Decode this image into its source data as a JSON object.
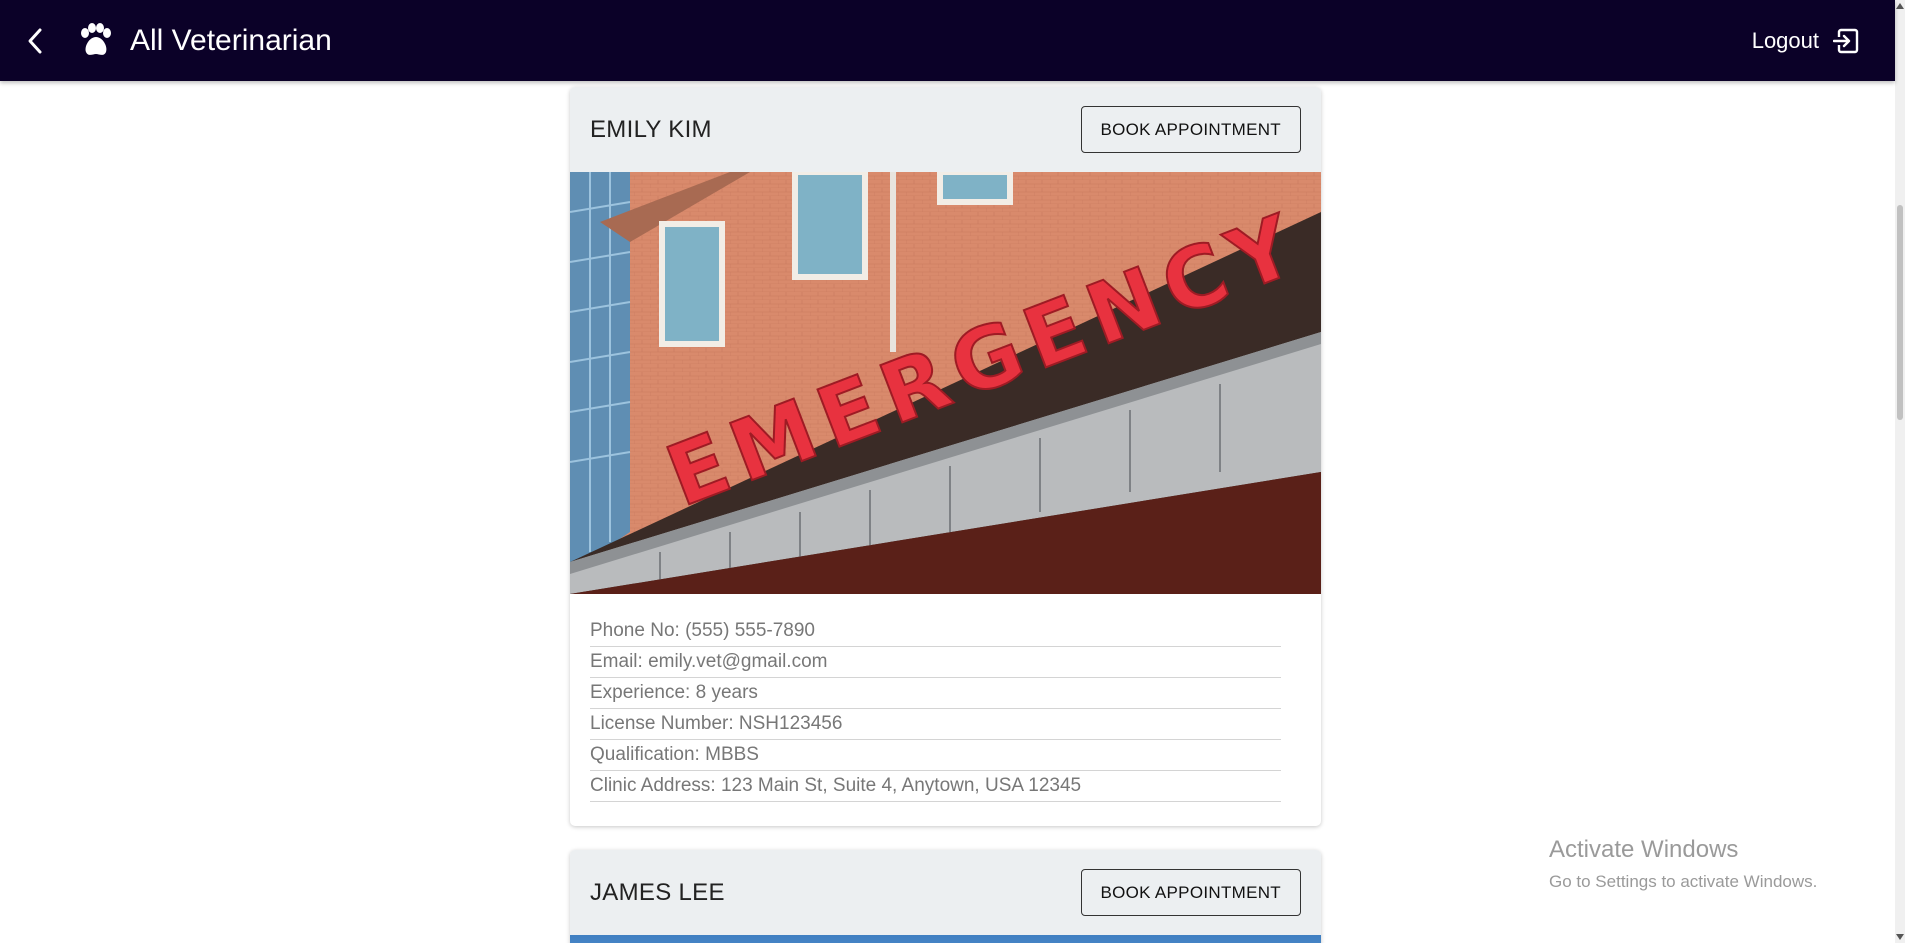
{
  "appbar": {
    "title": "All Veterinarian",
    "logout_label": "Logout",
    "back_icon": "chevron-left-icon",
    "logo_icon": "paw-icon",
    "logout_icon": "logout-icon",
    "background": "#0b0128"
  },
  "vets": [
    {
      "name": "EMILY KIM",
      "book_label": "BOOK APPOINTMENT",
      "photo_sign": "EMERGENCY",
      "details": [
        "Phone No: (555) 555-7890",
        "Email: emily.vet@gmail.com",
        "Experience: 8 years",
        "License Number: NSH123456",
        "Qualification: MBBS",
        "Clinic Address: 123 Main St, Suite 4, Anytown, USA 12345"
      ]
    },
    {
      "name": "JAMES LEE",
      "book_label": "BOOK APPOINTMENT"
    }
  ],
  "watermark": {
    "line1": "Activate Windows",
    "line2": "Go to Settings to activate Windows."
  }
}
